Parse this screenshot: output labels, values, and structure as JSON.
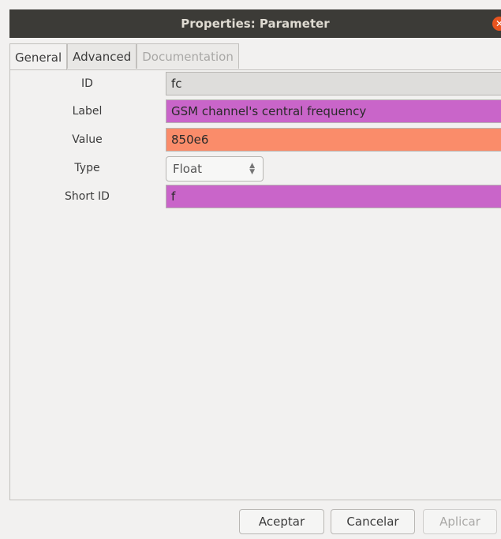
{
  "window": {
    "title": "Properties: Parameter"
  },
  "tabs": [
    {
      "label": "General",
      "active": true
    },
    {
      "label": "Advanced",
      "active": false
    },
    {
      "label": "Documentation",
      "enabled": false
    }
  ],
  "fields": {
    "id": {
      "label": "ID",
      "value": "fc",
      "color": "#dedddb"
    },
    "label": {
      "label": "Label",
      "value": "GSM channel's central frequency",
      "color": "#c965c9"
    },
    "value": {
      "label": "Value",
      "value": "850e6",
      "color": "#fa8c6a"
    },
    "type": {
      "label": "Type",
      "value": "Float"
    },
    "short_id": {
      "label": "Short ID",
      "value": "f",
      "color": "#c965c9"
    }
  },
  "buttons": {
    "ok": "Aceptar",
    "cancel": "Cancelar",
    "apply": "Aplicar"
  },
  "icons": {
    "close": "close-icon",
    "type_arrows": "up-down-arrows-icon"
  }
}
